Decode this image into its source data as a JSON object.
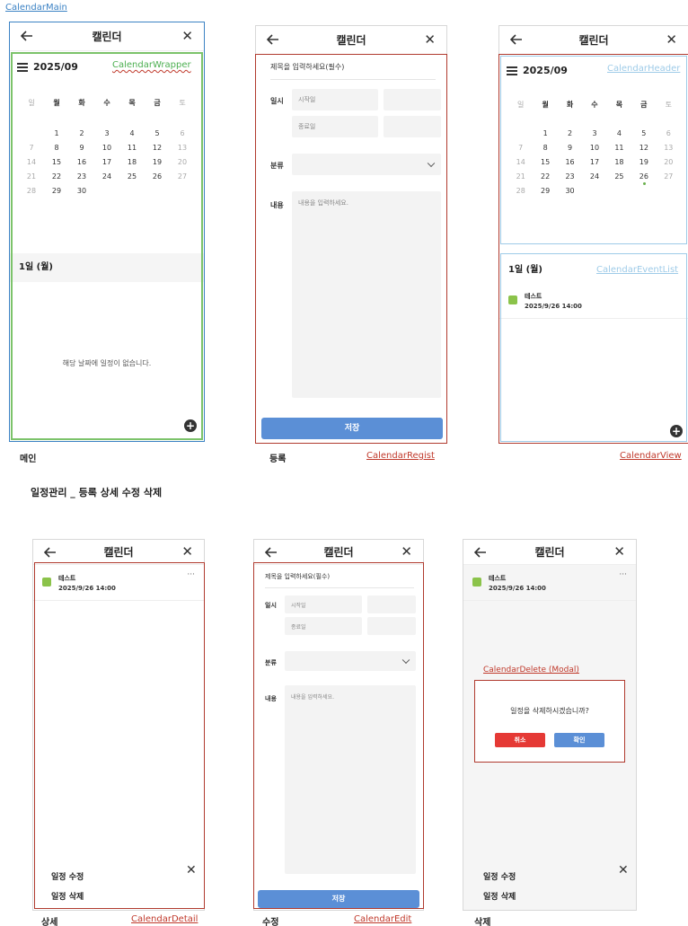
{
  "top_label": "CalendarMain",
  "section_title": "일정관리 _ 등록 상세 수정 삭제",
  "app_title": "캘린더",
  "close_glyph": "✕",
  "month": "2025/09",
  "weekdays": [
    "일",
    "월",
    "화",
    "수",
    "목",
    "금",
    "토"
  ],
  "weeks": [
    [
      "",
      "1",
      "2",
      "3",
      "4",
      "5",
      "6"
    ],
    [
      "7",
      "8",
      "9",
      "10",
      "11",
      "12",
      "13"
    ],
    [
      "14",
      "15",
      "16",
      "17",
      "18",
      "19",
      "20"
    ],
    [
      "21",
      "22",
      "23",
      "24",
      "25",
      "26",
      "27"
    ],
    [
      "28",
      "29",
      "30",
      "",
      "",
      "",
      ""
    ]
  ],
  "day_header": "1일 (월)",
  "empty_message": "해당 날짜에 일정이 없습니다.",
  "event": {
    "title": "테스트",
    "datetime": "2025/9/26 14:00",
    "more": "···"
  },
  "form": {
    "title_placeholder": "제목을 입력하세요(필수)",
    "date_label": "일시",
    "start_placeholder": "시작일",
    "end_placeholder": "종료일",
    "category_label": "분류",
    "content_label": "내용",
    "content_placeholder": "내용을 입력하세요.",
    "save_label": "저장"
  },
  "menu": {
    "edit": "일정 수정",
    "delete": "일정 삭제"
  },
  "modal": {
    "label": "CalendarDelete (Modal)",
    "message": "일정을 삭제하시겠습니까?",
    "cancel": "취소",
    "confirm": "확인"
  },
  "screens": {
    "main": {
      "caption": "메인",
      "component": "",
      "wrapper_label": "CalendarWrapper"
    },
    "regist": {
      "caption": "등록",
      "component": "CalendarRegist"
    },
    "view": {
      "caption": "",
      "component": "CalendarView",
      "header_label": "CalendarHeader",
      "eventlist_label": "CalendarEventList"
    },
    "detail": {
      "caption": "상세",
      "component": "CalendarDetail"
    },
    "edit": {
      "caption": "수정",
      "component": "CalendarEdit"
    },
    "delete": {
      "caption": "삭제"
    }
  },
  "colors": {
    "save": "#5b8fd6",
    "cancel": "#e53935",
    "confirm": "#5b8fd6",
    "event": "#8bc34a",
    "frame_red": "#b03a2e",
    "frame_blue": "#3b82c4",
    "frame_green": "#7cc36a"
  }
}
